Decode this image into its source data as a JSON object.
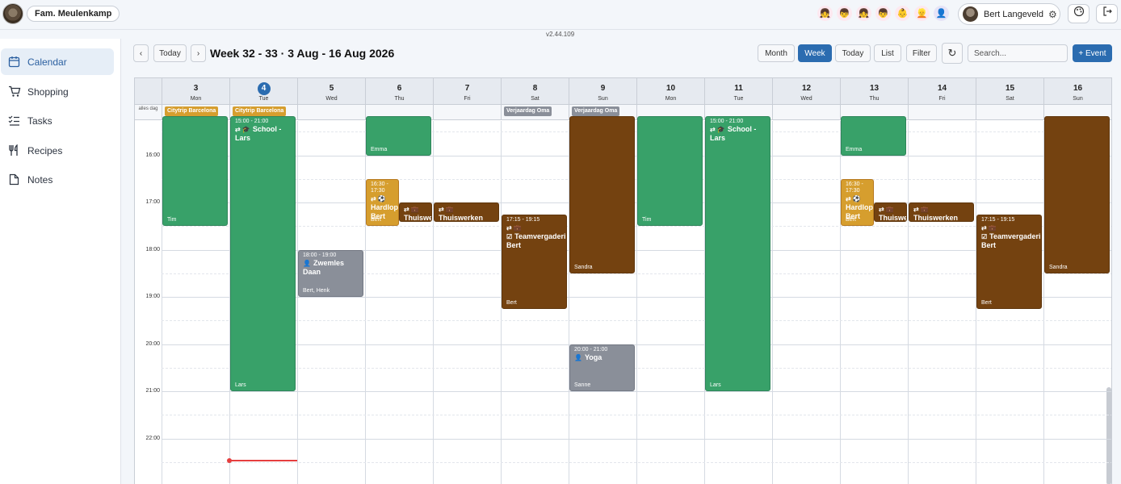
{
  "app": {
    "family_label": "Fam. Meulenkamp",
    "version": "v2.44.109",
    "user_name": "Bert Langeveld"
  },
  "avatars": [
    "👧",
    "👦",
    "👧",
    "👦",
    "👶",
    "👱",
    "👤"
  ],
  "sidebar": {
    "items": [
      {
        "label": "Calendar",
        "icon": "calendar-icon",
        "active": true
      },
      {
        "label": "Shopping",
        "icon": "cart-icon",
        "active": false
      },
      {
        "label": "Tasks",
        "icon": "checklist-icon",
        "active": false
      },
      {
        "label": "Recipes",
        "icon": "utensils-icon",
        "active": false
      },
      {
        "label": "Notes",
        "icon": "note-icon",
        "active": false
      }
    ]
  },
  "toolbar": {
    "prev": "‹",
    "today_left": "Today",
    "next": "›",
    "title": "Week 32 - 33 · 3 Aug - 16 Aug 2026",
    "view_month": "Month",
    "view_week": "Week",
    "today_right": "Today",
    "view_list": "List",
    "filter": "Filter",
    "refresh": "↻",
    "search_placeholder": "Search...",
    "add_event": "+ Event"
  },
  "days": [
    {
      "num": "3",
      "name": "Mon"
    },
    {
      "num": "4",
      "name": "Tue",
      "today": true
    },
    {
      "num": "5",
      "name": "Wed"
    },
    {
      "num": "6",
      "name": "Thu"
    },
    {
      "num": "7",
      "name": "Fri"
    },
    {
      "num": "8",
      "name": "Sat"
    },
    {
      "num": "9",
      "name": "Sun"
    },
    {
      "num": "10",
      "name": "Mon"
    },
    {
      "num": "11",
      "name": "Tue"
    },
    {
      "num": "12",
      "name": "Wed"
    },
    {
      "num": "13",
      "name": "Thu"
    },
    {
      "num": "14",
      "name": "Fri"
    },
    {
      "num": "15",
      "name": "Sat"
    },
    {
      "num": "16",
      "name": "Sun"
    }
  ],
  "allday_label": "alles dag",
  "allday_events": [
    {
      "day": 0,
      "title": "Citytrip Barcelona",
      "color": "#d69e2e"
    },
    {
      "day": 1,
      "title": "Citytrip Barcelona",
      "color": "#d69e2e"
    },
    {
      "day": 5,
      "title": "Verjaardag Oma",
      "color": "#8a8f99"
    },
    {
      "day": 6,
      "title": "Verjaardag Oma",
      "color": "#8a8f99"
    }
  ],
  "hours": [
    "16:00",
    "17:00",
    "18:00",
    "19:00",
    "20:00",
    "21:00",
    "22:00"
  ],
  "events": [
    {
      "day": 0,
      "start": 14.0,
      "end": 17.5,
      "color": "green",
      "owner": "Tim"
    },
    {
      "day": 1,
      "start": 15.0,
      "end": 21.0,
      "color": "green",
      "time": "15:00 - 21:00",
      "icons": "⇄ 🎓",
      "title": "School - Lars",
      "owner": "Lars"
    },
    {
      "day": 2,
      "start": 18.0,
      "end": 19.0,
      "color": "gray",
      "time": "18:00 - 19:00",
      "icons": "👤",
      "title": "Zwemles Daan",
      "owner": "Bert, Henk"
    },
    {
      "day": 3,
      "start": 14.0,
      "end": 16.0,
      "color": "green",
      "owner": "Emma"
    },
    {
      "day": 3,
      "start": 16.5,
      "end": 17.5,
      "color": "orange",
      "width": "half",
      "time": "16:30 - 17:30",
      "icons": "⇄ ⚽",
      "title": "Hardlop Bert",
      "owner": "Bert"
    },
    {
      "day": 3,
      "start": 17.0,
      "end": 17.4,
      "color": "brown",
      "width": "halfright",
      "icons": "⇄ 💼",
      "title": "Thuiswe"
    },
    {
      "day": 4,
      "start": 17.0,
      "end": 17.4,
      "color": "brown",
      "icons": "⇄ 💼",
      "title": "Thuiswerken Bert"
    },
    {
      "day": 5,
      "start": 17.25,
      "end": 19.25,
      "color": "brown",
      "time": "17:15 - 19:15",
      "icons": "⇄ 💼 ☑",
      "title": "Teamvergadering Bert",
      "owner": "Bert"
    },
    {
      "day": 6,
      "start": 14.0,
      "end": 18.5,
      "color": "brown",
      "owner": "Sandra"
    },
    {
      "day": 6,
      "start": 20.0,
      "end": 21.0,
      "color": "gray",
      "time": "20:00 - 21:00",
      "icons": "👤",
      "title": "Yoga",
      "owner": "Sanne"
    },
    {
      "day": 7,
      "start": 14.0,
      "end": 17.5,
      "color": "green",
      "owner": "Tim"
    },
    {
      "day": 8,
      "start": 15.0,
      "end": 21.0,
      "color": "green",
      "time": "15:00 - 21:00",
      "icons": "⇄ 🎓",
      "title": "School - Lars",
      "owner": "Lars"
    },
    {
      "day": 10,
      "start": 14.0,
      "end": 16.0,
      "color": "green",
      "owner": "Emma"
    },
    {
      "day": 10,
      "start": 16.5,
      "end": 17.5,
      "color": "orange",
      "width": "half",
      "time": "16:30 - 17:30",
      "icons": "⇄ ⚽",
      "title": "Hardlop Bert",
      "owner": "Bert"
    },
    {
      "day": 10,
      "start": 17.0,
      "end": 17.4,
      "color": "brown",
      "width": "halfright",
      "icons": "⇄ 💼",
      "title": "Thuiswe"
    },
    {
      "day": 11,
      "start": 17.0,
      "end": 17.4,
      "color": "brown",
      "icons": "⇄ 💼",
      "title": "Thuiswerken Bert"
    },
    {
      "day": 12,
      "start": 17.25,
      "end": 19.25,
      "color": "brown",
      "time": "17:15 - 19:15",
      "icons": "⇄ 💼 ☑",
      "title": "Teamvergadering Bert",
      "owner": "Bert"
    },
    {
      "day": 13,
      "start": 14.0,
      "end": 18.5,
      "color": "brown",
      "owner": "Sandra"
    }
  ],
  "now": {
    "day": 1,
    "time": 22.45
  }
}
